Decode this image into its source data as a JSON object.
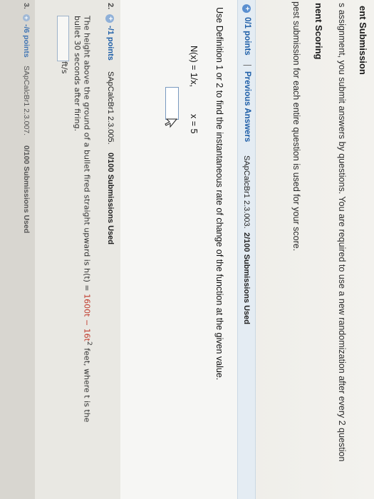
{
  "header": {
    "title": "ent Submission",
    "line1": "s assignment, you submit answers by questions. You are required to use a new randomization after every 2 question",
    "scoring_title": "nent Scoring",
    "line2": "pest submission for each entire question is used for your score."
  },
  "question1": {
    "points": "0/1 points",
    "separator": "|",
    "previous": "Previous Answers",
    "ref": "SApCalcBr1 2.3.003.",
    "submissions": "2/100 Submissions Used",
    "prompt": "Use Definition 1 or 2 to find the instantaneous rate of change of the function at the given value.",
    "function": "N(x) = 1/x,",
    "value": "x = 5",
    "answer_value": ""
  },
  "question2": {
    "number": "2.",
    "points": "-/1 points",
    "ref": "SApCalcBr1 2.3.005.",
    "submissions": "0/100 Submissions Used",
    "text_a": "The height above the ground of a bullet fired straight upward is  h(t) = ",
    "formula": "1600t − 16t",
    "exponent": "2",
    "text_b": "  feet, where t is the",
    "text_c": "bullet 30 seconds after firing.",
    "unit": "ft/s"
  },
  "question3": {
    "number": "3.",
    "points": "-/6 points",
    "ref": "SApCalcBr1 2.3.007.",
    "submissions": "0/100 Submissions Used"
  },
  "colors": {
    "accent": "#1f5fa8",
    "header_band": "#e4ecf3",
    "highlight_red": "#c0392b"
  }
}
